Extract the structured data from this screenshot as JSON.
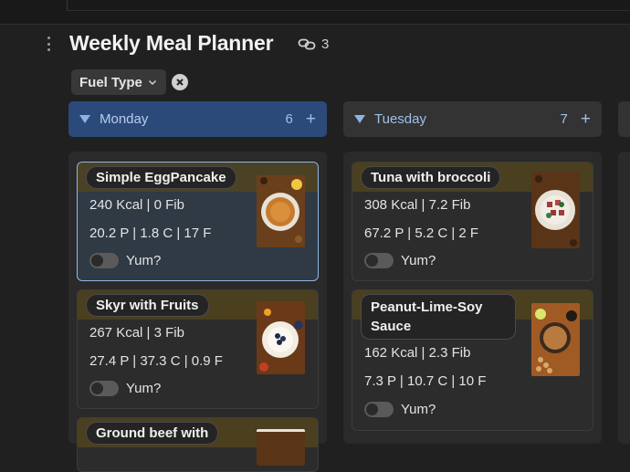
{
  "page": {
    "title": "Weekly Meal Planner",
    "linked_count": "3"
  },
  "filter": {
    "label": "Fuel Type"
  },
  "columns": [
    {
      "name": "Monday",
      "count": "6",
      "add_label": "+",
      "cards": [
        {
          "title": "Simple EggPancake",
          "kcal_line": "240 Kcal | 0 Fib",
          "macro_line": "20.2 P | 1.8 C | 17 F",
          "toggle_label": "Yum?",
          "image": "pancake-plate"
        },
        {
          "title": "Skyr with Fruits",
          "kcal_line": "267 Kcal | 3 Fib",
          "macro_line": "27.4 P | 37.3 C | 0.9 F",
          "toggle_label": "Yum?",
          "image": "yogurt-bowl"
        },
        {
          "title": "Ground beef with",
          "image": "beef-dish"
        }
      ]
    },
    {
      "name": "Tuesday",
      "count": "7",
      "add_label": "+",
      "cards": [
        {
          "title": "Tuna with broccoli",
          "kcal_line": "308 Kcal | 7.2 Fib",
          "macro_line": "67.2 P | 5.2 C | 2 F",
          "toggle_label": "Yum?",
          "image": "tuna-plate"
        },
        {
          "title": "Peanut-Lime-Soy Sauce",
          "kcal_line": "162 Kcal | 2.3 Fib",
          "macro_line": "7.3 P | 10.7 C | 10 F",
          "toggle_label": "Yum?",
          "image": "sauce-bowl"
        }
      ]
    }
  ],
  "colors": {
    "accent": "#2b4a7a",
    "card_band": "#4a3f1f",
    "selected_border": "#8fb8e6"
  }
}
